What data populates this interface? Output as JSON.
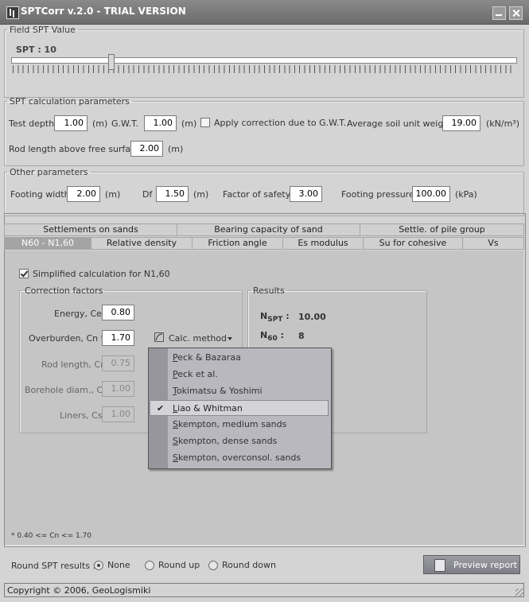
{
  "window": {
    "title": "SPTCorr v.2.0 - TRIAL VERSION"
  },
  "field_spt": {
    "legend": "Field SPT Value",
    "label": "SPT : 10",
    "value": 10
  },
  "spt_params": {
    "legend": "SPT calculation parameters",
    "test_depth_label": "Test depth",
    "test_depth": "1.00",
    "test_depth_unit": "(m)",
    "gwt_label": "G.W.T.",
    "gwt": "1.00",
    "gwt_unit": "(m)",
    "apply_gwt_label": "Apply correction due to G.W.T.",
    "apply_gwt_checked": false,
    "unit_weight_label": "Average soil unit weight",
    "unit_weight": "19.00",
    "unit_weight_unit": "(kN/m³)",
    "rod_length_label": "Rod length above free surface",
    "rod_length": "2.00",
    "rod_length_unit": "(m)"
  },
  "other_params": {
    "legend": "Other parameters",
    "footing_width_label": "Footing width",
    "footing_width": "2.00",
    "footing_width_unit": "(m)",
    "df_label": "Df",
    "df": "1.50",
    "df_unit": "(m)",
    "fos_label": "Factor of safety",
    "fos": "3.00",
    "pressure_label": "Footing pressure",
    "pressure": "100.00",
    "pressure_unit": "(kPa)"
  },
  "tabs_row1": [
    "Settlements on sands",
    "Bearing capacity of sand",
    "Settle. of pile group"
  ],
  "tabs_row2": [
    "N60 - N1,60",
    "Relative density",
    "Friction angle",
    "Es modulus",
    "Su for cohesive",
    "Vs"
  ],
  "active_tab": "N60 - N1,60",
  "n60": {
    "simplified_label": "Simplified calculation for N1,60",
    "simplified_checked": true,
    "correction_legend": "Correction factors",
    "energy_label": "Energy, Ce",
    "energy": "0.80",
    "overburden_label": "Overburden, Cn *",
    "overburden": "1.70",
    "calc_method_label": "Calc. method",
    "rod_label": "Rod length, Cr",
    "rod": "0.75",
    "borehole_label": "Borehole diam., Cb",
    "borehole": "1.00",
    "liners_label": "Liners, Cs",
    "liners": "1.00",
    "results_legend": "Results",
    "nspt_main": "N",
    "nspt_sub": "SPT",
    "nspt_colon": ":",
    "nspt_value": "10.00",
    "n60_main": "N",
    "n60_sub": "60",
    "n60_colon": ":",
    "n60_value": "8",
    "footnote": "* 0.40 <= Cn <= 1.70"
  },
  "calc_menu": {
    "items": [
      "Peck & Bazaraa",
      "Peck et al.",
      "Tokimatsu & Yoshimi",
      "Liao & Whitman",
      "Skempton, medium sands",
      "Skempton, dense sands",
      "Skempton, overconsol. sands"
    ],
    "checked_index": 3
  },
  "round": {
    "label": "Round SPT results :",
    "options": [
      "None",
      "Round up",
      "Round down"
    ],
    "selected": "None"
  },
  "preview_button": "Preview report",
  "status_bar": "Copyright © 2006, GeoLogismiki",
  "colors": {
    "titlebar": "#7a7a7a",
    "panel": "#c5c5c5",
    "menu": "#b8b8be",
    "active_tab": "#a4a4a4"
  }
}
